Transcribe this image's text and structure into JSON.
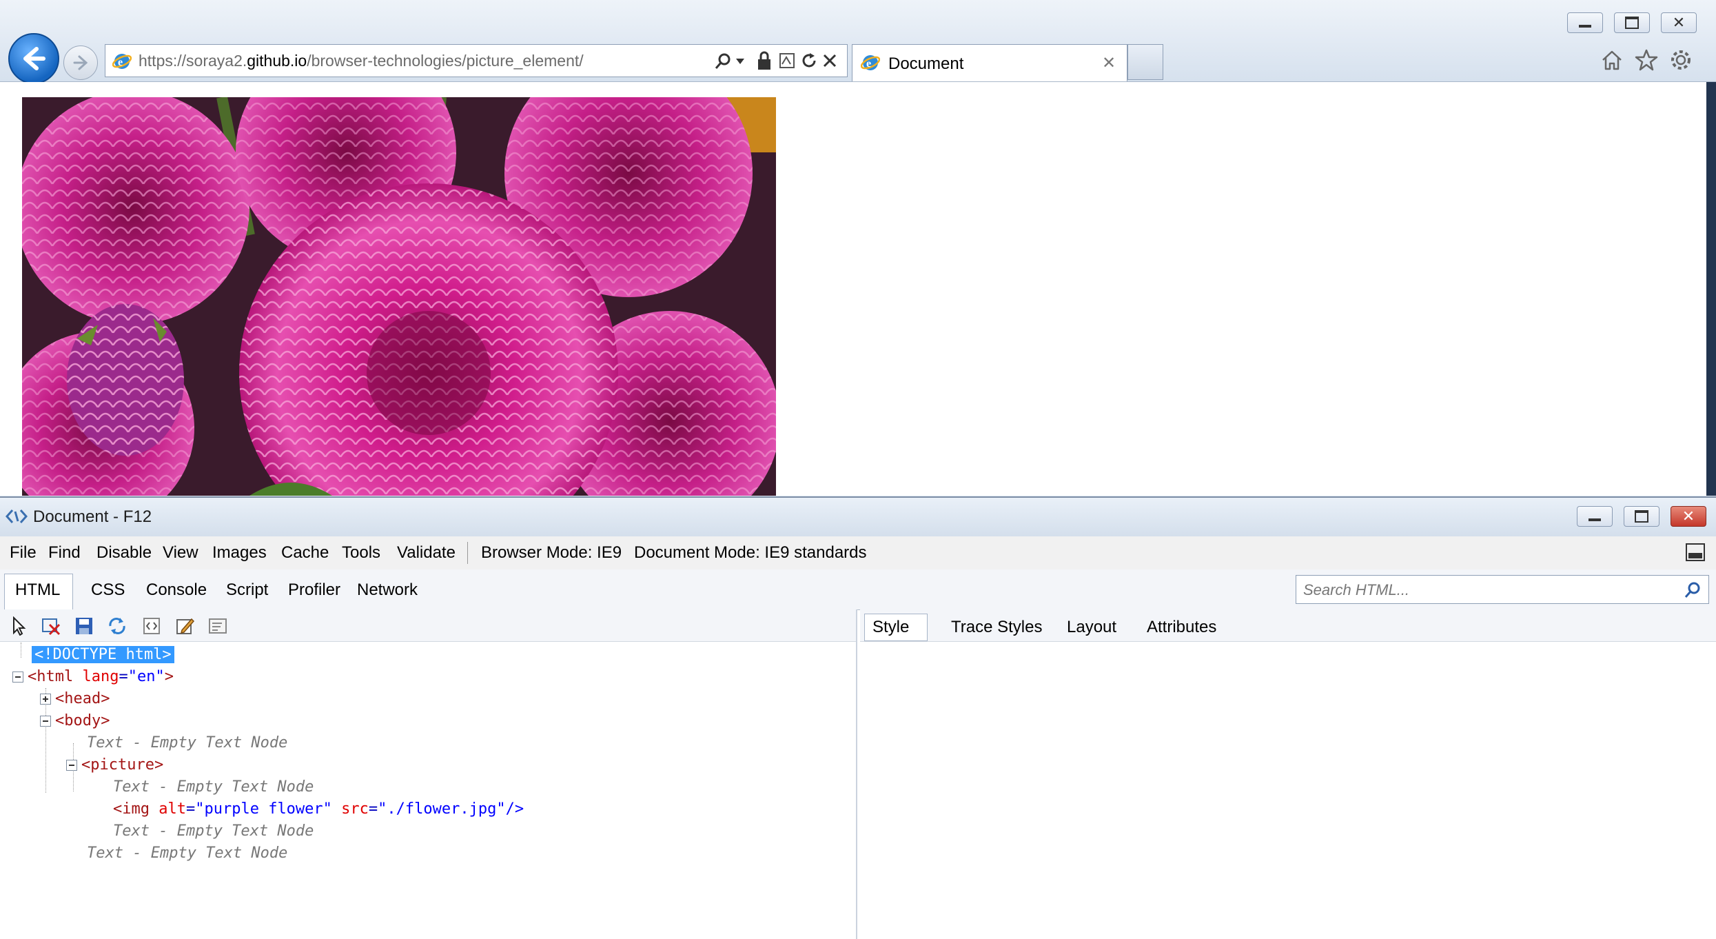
{
  "browser": {
    "address": {
      "prefix": "https://soraya2.",
      "domain": "github.io",
      "path": "/browser-technologies/picture_element/"
    },
    "tab_title": "Document",
    "image_alt": "purple flower"
  },
  "devtools": {
    "title": "Document - F12",
    "menu": [
      "File",
      "Find",
      "Disable",
      "View",
      "Images",
      "Cache",
      "Tools",
      "Validate"
    ],
    "browser_mode": "Browser Mode: IE9",
    "document_mode": "Document Mode: IE9 standards",
    "tabs": [
      "HTML",
      "CSS",
      "Console",
      "Script",
      "Profiler",
      "Network"
    ],
    "search_placeholder": "Search HTML...",
    "right_tabs": [
      "Style",
      "Trace Styles",
      "Layout",
      "Attributes"
    ],
    "tree": {
      "doctype": "<!DOCTYPE html>",
      "html_open": "<html",
      "html_attr": "lang",
      "html_val": "\"en\"",
      "html_close": ">",
      "head": "<head>",
      "body": "<body>",
      "text_node": "Text - Empty Text Node",
      "picture": "<picture>",
      "img_open": "<img",
      "img_alt_attr": "alt",
      "img_alt_val": "\"purple flower\"",
      "img_src_attr": "src",
      "img_src_val": "\"./flower.jpg\"",
      "img_close": "/>"
    }
  }
}
